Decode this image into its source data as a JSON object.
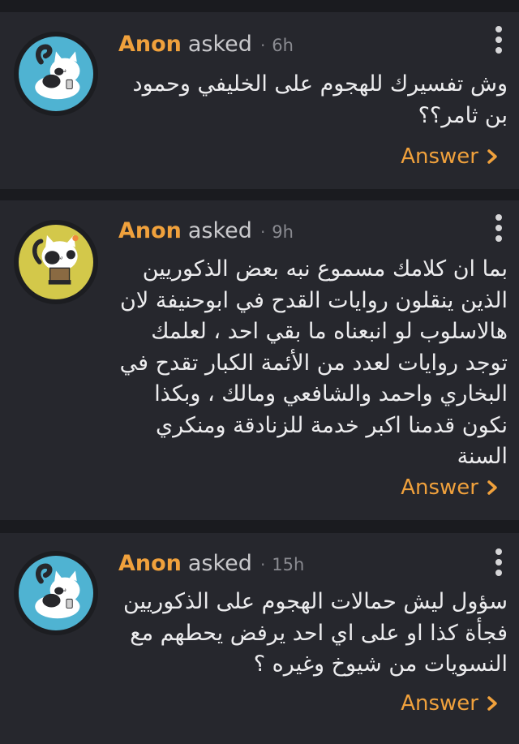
{
  "questions": [
    {
      "name": "Anon",
      "asked": "asked",
      "separator": "·",
      "time": "6h",
      "avatar": "blue-cat-avatar",
      "text": "وش تفسيرك للهجوم على الخليفي وحمود بن ثامر؟؟",
      "answer_label": "Answer"
    },
    {
      "name": "Anon",
      "asked": "asked",
      "separator": "·",
      "time": "9h",
      "avatar": "yellow-cat-avatar",
      "text": "بما ان كلامك مسموع نبه بعض الذكوريين الذين ينقلون روايات القدح في ابوحنيفة لان هالاسلوب لو انبعناه ما بقي احد ، لعلمك توجد روايات لعدد من الأئمة الكبار تقدح في البخاري واحمد والشافعي ومالك ، وبكذا نكون قدمنا اكبر خدمة للزنادقة ومنكري السنة",
      "answer_label": "Answer"
    },
    {
      "name": "Anon",
      "asked": "asked",
      "separator": "·",
      "time": "15h",
      "avatar": "blue-cat-avatar",
      "text": "سؤول ليش حمالات الهجوم على الذكوريين فجأة كذا او على اي احد يرفض يحطهم مع النسويات من شيوخ وغيره ؟",
      "answer_label": "Answer"
    }
  ],
  "colors": {
    "accent": "#f0a13c",
    "card": "#26272d",
    "background": "#1a1b1f",
    "avatar_blue": "#4fb3d2",
    "avatar_yellow": "#d3c84a"
  }
}
